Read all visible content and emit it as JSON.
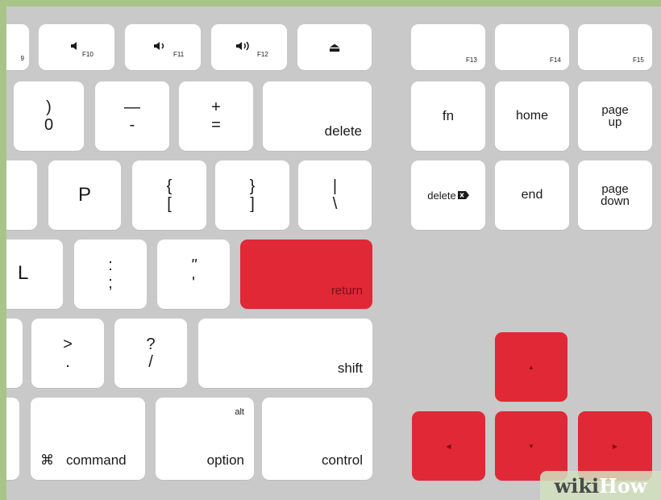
{
  "keys": {
    "f9": "9",
    "f10": "F10",
    "f11": "F11",
    "f12": "F12",
    "f13": "F13",
    "f14": "F14",
    "f15": "F15",
    "zero_top": ")",
    "zero_bottom": "0",
    "minus_top": "—",
    "minus_bottom": "-",
    "equals_top": "+",
    "equals_bottom": "=",
    "delete": "delete",
    "fn": "fn",
    "home": "home",
    "page_up_1": "page",
    "page_up_2": "up",
    "p": "P",
    "lbrace_top": "{",
    "lbrace_bottom": "[",
    "rbrace_top": "}",
    "rbrace_bottom": "]",
    "pipe_top": "|",
    "pipe_bottom": "\\",
    "forward_delete": "delete",
    "end": "end",
    "page_down_1": "page",
    "page_down_2": "down",
    "l": "L",
    "colon_top": ":",
    "colon_bottom": ";",
    "quote_top": "\"",
    "quote_bottom": "'",
    "return": "return",
    "gt_top": ">",
    "gt_bottom": ".",
    "q_top": "?",
    "q_bottom": "/",
    "shift": "shift",
    "command_symbol": "⌘",
    "command": "command",
    "alt": "alt",
    "option": "option",
    "control": "control"
  },
  "icons": {
    "eject": "⏏",
    "up": "▲",
    "down": "▼",
    "left": "◀",
    "right": "▶"
  },
  "watermark": {
    "part1": "wiki",
    "part2": "How"
  },
  "colors": {
    "highlight": "#e02836",
    "board": "#c9c9c9",
    "key": "#ffffff"
  }
}
